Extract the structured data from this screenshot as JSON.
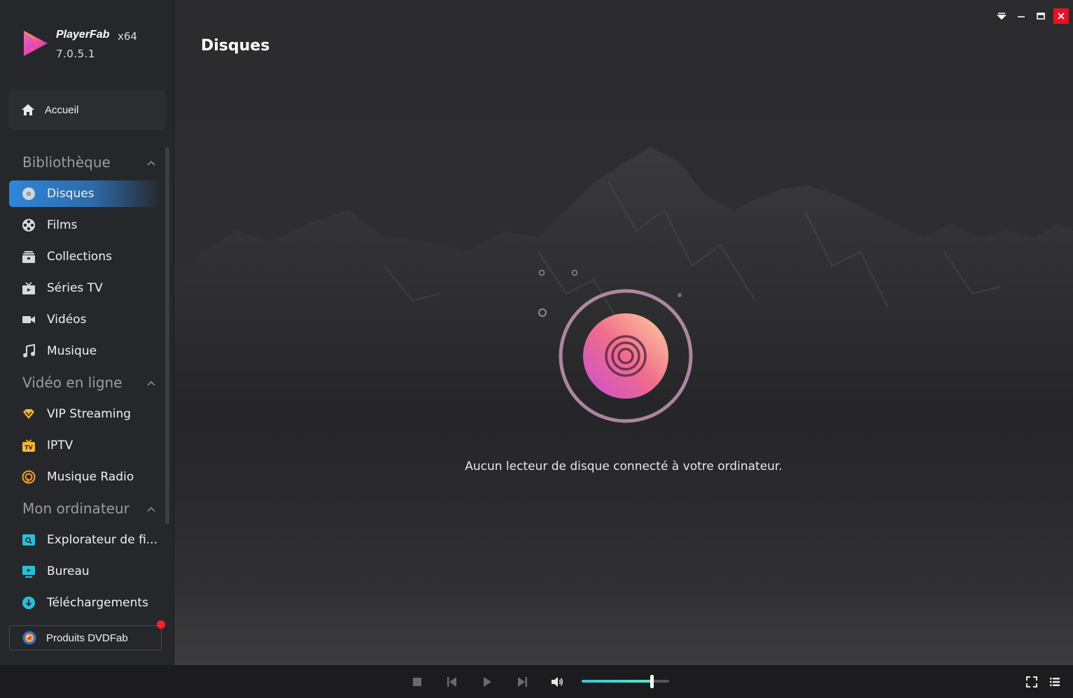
{
  "app": {
    "brand": "PlayerFab",
    "arch": "x64",
    "version": "7.0.5.1"
  },
  "sidebar": {
    "home": {
      "label": "Accueil",
      "icon": "home-icon"
    },
    "sections": [
      {
        "label": "Bibliothèque",
        "items": [
          {
            "label": "Disques",
            "icon": "disc-icon",
            "active": true
          },
          {
            "label": "Films",
            "icon": "film-reel-icon"
          },
          {
            "label": "Collections",
            "icon": "collection-icon"
          },
          {
            "label": "Séries TV",
            "icon": "tv-series-icon"
          },
          {
            "label": "Vidéos",
            "icon": "video-camera-icon"
          },
          {
            "label": "Musique",
            "icon": "music-note-icon"
          }
        ]
      },
      {
        "label": "Vidéo en ligne",
        "items": [
          {
            "label": "VIP Streaming",
            "icon": "vip-diamond-icon"
          },
          {
            "label": "IPTV",
            "icon": "iptv-icon"
          },
          {
            "label": "Musique Radio",
            "icon": "radio-icon"
          }
        ]
      },
      {
        "label": "Mon ordinateur",
        "items": [
          {
            "label": "Explorateur de fi...",
            "icon": "file-explorer-icon"
          },
          {
            "label": "Bureau",
            "icon": "desktop-icon"
          },
          {
            "label": "Téléchargements",
            "icon": "download-icon"
          }
        ]
      }
    ],
    "products": {
      "label": "Produits DVDFab",
      "icon": "dvdfab-logo-icon",
      "has_notification": true
    }
  },
  "main": {
    "title": "Disques",
    "empty_message": "Aucun lecteur de disque connecté à votre ordinateur."
  },
  "player": {
    "volume": 0.8
  },
  "colors": {
    "accent": "#2f86d9",
    "close": "#e81123",
    "notification": "#ff1e2d",
    "volume": "#4fd8d0"
  }
}
